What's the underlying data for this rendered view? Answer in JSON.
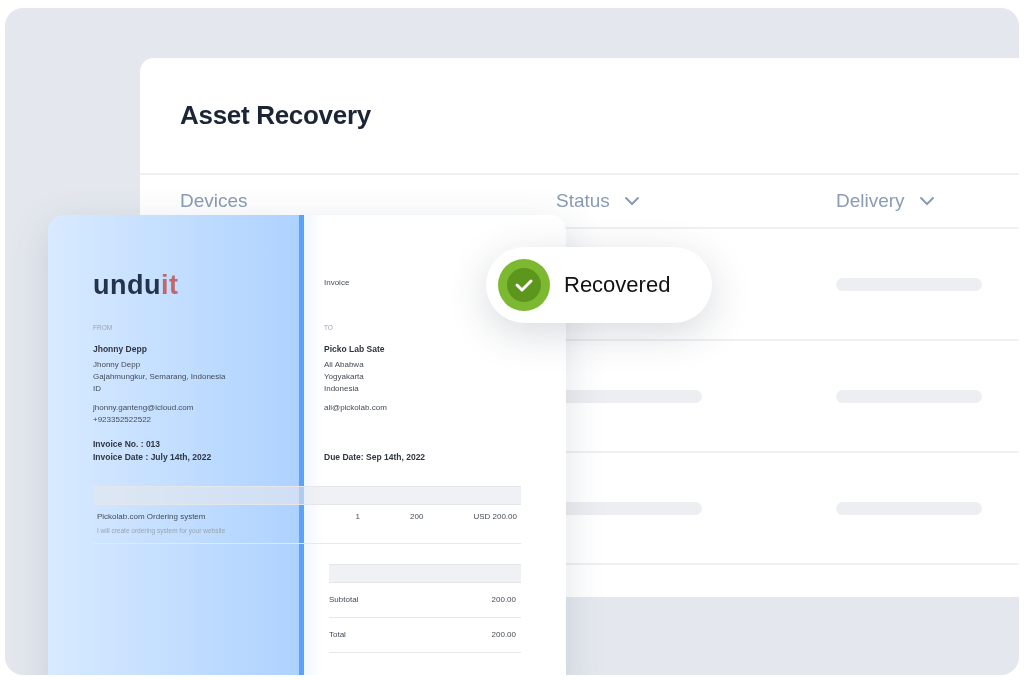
{
  "title": "Asset Recovery",
  "table": {
    "columns": [
      {
        "label": "Devices",
        "sortable": false
      },
      {
        "label": "Status",
        "sortable": true
      },
      {
        "label": "Delivery",
        "sortable": true
      }
    ],
    "rows": [
      {
        "status": {
          "kind": "badge",
          "label": "Recovered"
        },
        "delivery": {
          "kind": "skeleton"
        }
      },
      {
        "status": {
          "kind": "skeleton"
        },
        "delivery": {
          "kind": "skeleton"
        }
      },
      {
        "status": {
          "kind": "skeleton"
        },
        "delivery": {
          "kind": "skeleton"
        }
      }
    ]
  },
  "invoice": {
    "logo": {
      "main": "undu",
      "accent": "it"
    },
    "heading": "Invoice",
    "from": {
      "label": "FROM",
      "name": "Jhonny Depp",
      "lines": [
        "Jhonny Depp",
        "Gajahmungkur, Semarang, Indonesia",
        "ID"
      ],
      "contact": [
        "jhonny.ganteng@icloud.com",
        "+923352522522"
      ]
    },
    "to": {
      "label": "TO",
      "name": "Picko Lab Sate",
      "lines": [
        "Ali Ababwa",
        "Yogyakarta",
        "Indonesia"
      ],
      "contact": [
        "ali@pickolab.com"
      ]
    },
    "meta": [
      "Invoice No. : 013",
      "Invoice Date : July 14th, 2022"
    ],
    "due": "Due Date: Sep 14th, 2022",
    "items": [
      {
        "title": "Pickolab.com Ordering system",
        "description": "I will create ordering system for your website",
        "qty": "1",
        "price": "200",
        "amount": "USD 200.00"
      }
    ],
    "totals": [
      {
        "label": "Subtotal",
        "value": "200.00"
      },
      {
        "label": "Total",
        "value": "200.00"
      }
    ]
  }
}
